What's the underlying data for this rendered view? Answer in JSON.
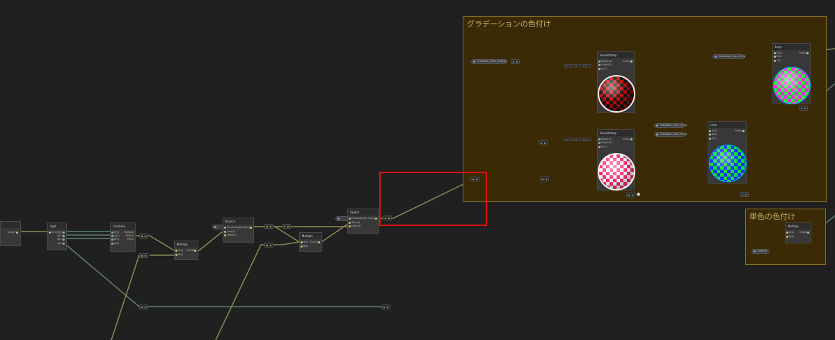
{
  "groups": {
    "gradient": {
      "title": "グラデーションの色付け"
    },
    "single": {
      "title": "単色の色付け"
    }
  },
  "nodes": {
    "edge_left": {
      "title": "",
      "out": "Out(4)"
    },
    "split": {
      "title": "Split",
      "in": "In(4)",
      "outs": [
        "R(1)",
        "G(1)",
        "B(1)",
        "A(1)"
      ]
    },
    "combine": {
      "title": "Combine",
      "ins": [
        "R(1)",
        "G(1)",
        "B(1)",
        "A(1)"
      ],
      "outs": [
        "RGBA(4)",
        "RGB(3)",
        "RG(2)"
      ]
    },
    "multiply1": {
      "title": "Multiply",
      "ins": [
        "A(1)",
        "B(1)"
      ],
      "out": "Out(1)"
    },
    "branch": {
      "title": "Branch",
      "ins": [
        "Predicate(B)",
        "True(1)",
        "False(1)"
      ],
      "out": "Out(1)"
    },
    "multiply2": {
      "title": "Multiply",
      "ins": [
        "A(1)",
        "B(1)"
      ],
      "out": "Out(1)"
    },
    "switch": {
      "title": "Switch",
      "ins": [
        "Predicate(B)",
        "True(4)",
        "False(4)"
      ],
      "out": "Out(4)"
    },
    "smoothstep1": {
      "title": "Smoothstep",
      "ins": [
        "Edge1(1)",
        "Edge2(1)",
        "In(1)"
      ],
      "out": "Out(1)"
    },
    "smoothstep2": {
      "title": "Smoothstep",
      "ins": [
        "Edge1(1)",
        "Edge2(1)",
        "In(1)"
      ],
      "out": "Out(1)"
    },
    "lerp1": {
      "title": "Lerp",
      "ins": [
        "A(4)",
        "B(4)",
        "T(1)"
      ],
      "out": "Out(4)"
    },
    "lerp2": {
      "title": "Lerp",
      "ins": [
        "A(4)",
        "B(4)",
        "T(1)"
      ],
      "out": "Out(4)"
    },
    "multiply3": {
      "title": "Multiply",
      "ins": [
        "A(4)",
        "B(4)"
      ],
      "out": "Out(4)"
    }
  },
  "properties": {
    "grad_edge": "Gradation_Color_Edge(1)",
    "grad_color1": "Gradation_Color_01(4)",
    "grad_color2": "Gradation_Color_02(4)",
    "grad_color3": "Gradation_Color_03(4)",
    "single_color": "Color(4)",
    "branch_pred": "",
    "switch_pred": ""
  },
  "chips": [
    "0",
    "0",
    "0",
    "0",
    "0",
    "0"
  ],
  "colors": {
    "background": "#202020",
    "group_fill": "#3a2a06",
    "group_border": "#8c7226",
    "wire_yellow": "#8f8a55",
    "wire_teal": "#5e8070",
    "selection": "#e01010"
  }
}
